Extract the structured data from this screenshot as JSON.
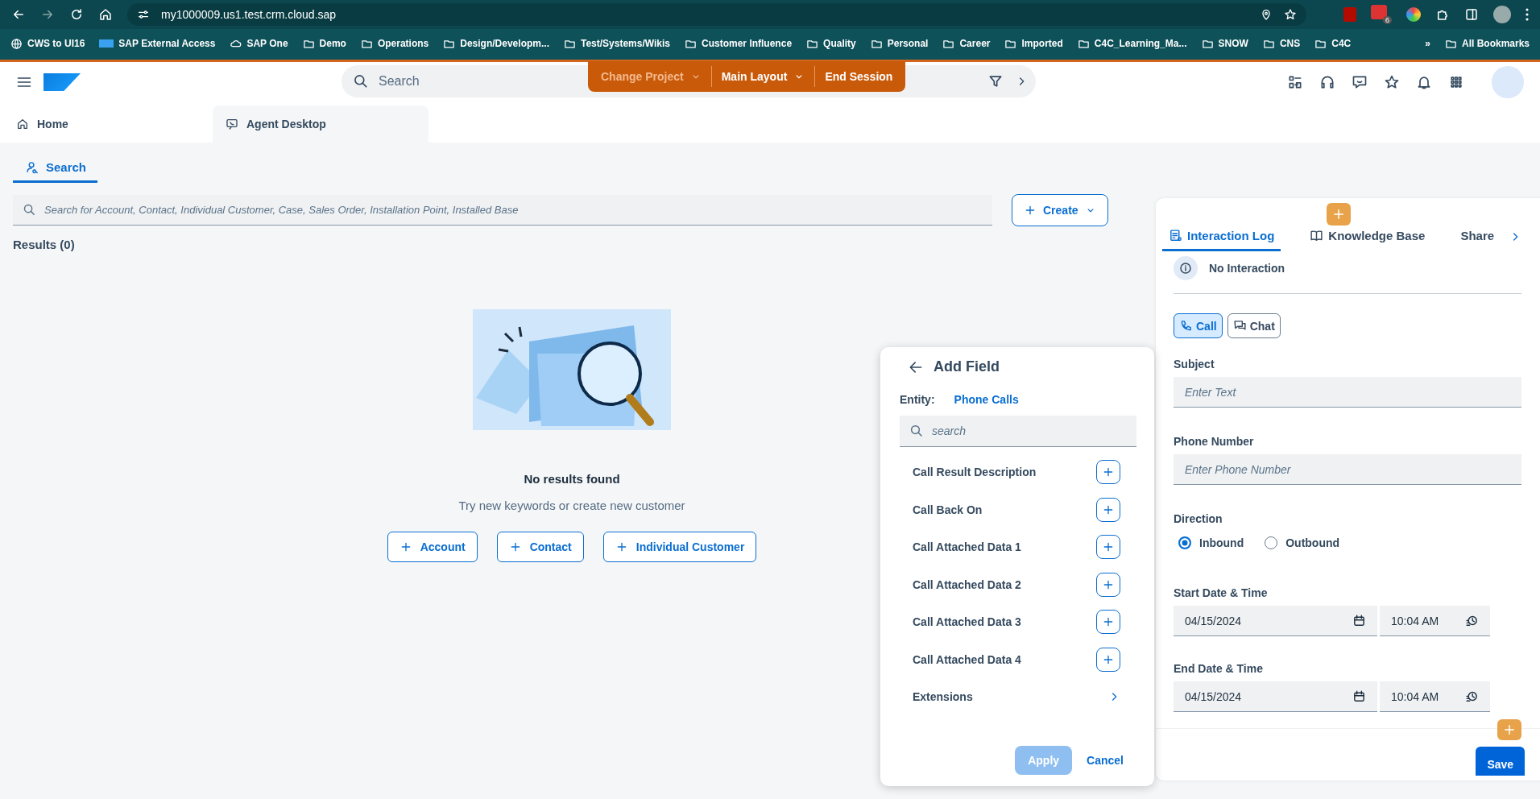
{
  "browser": {
    "url": "my1000009.us1.test.crm.cloud.sap",
    "extension_badge": "6",
    "bookmarks": [
      {
        "label": "CWS to UI16",
        "kind": "globe"
      },
      {
        "label": "SAP External Access",
        "kind": "sap"
      },
      {
        "label": "SAP One",
        "kind": "cloud"
      },
      {
        "label": "Demo",
        "kind": "folder"
      },
      {
        "label": "Operations",
        "kind": "folder"
      },
      {
        "label": "Design/Developm...",
        "kind": "folder"
      },
      {
        "label": "Test/Systems/Wikis",
        "kind": "folder"
      },
      {
        "label": "Customer Influence",
        "kind": "folder"
      },
      {
        "label": "Quality",
        "kind": "folder"
      },
      {
        "label": "Personal",
        "kind": "folder"
      },
      {
        "label": "Career",
        "kind": "folder"
      },
      {
        "label": "Imported",
        "kind": "folder"
      },
      {
        "label": "C4C_Learning_Ma...",
        "kind": "folder"
      },
      {
        "label": "SNOW",
        "kind": "folder"
      },
      {
        "label": "CNS",
        "kind": "folder"
      },
      {
        "label": "C4C",
        "kind": "folder"
      }
    ],
    "overflow": "»",
    "all_bookmarks": "All Bookmarks"
  },
  "shell": {
    "search_placeholder": "Search",
    "actions": [
      {
        "label": "Change Project",
        "dimmed": true,
        "menu": true
      },
      {
        "label": "Main Layout",
        "dimmed": false,
        "menu": true
      },
      {
        "label": "End Session",
        "dimmed": false,
        "menu": false
      }
    ]
  },
  "page_tabs": [
    {
      "label": "Home",
      "kind": "home",
      "selected": false
    },
    {
      "label": "Agent Desktop",
      "kind": "agent",
      "selected": true
    }
  ],
  "search_pane": {
    "tab": "Search",
    "placeholder": "Search for Account, Contact, Individual Customer, Case, Sales Order, Installation Point, Installed Base",
    "create": "Create",
    "results": "Results (0)",
    "empty_title": "No results found",
    "empty_text": "Try new keywords or create new customer",
    "quick_create": [
      "Account",
      "Contact",
      "Individual Customer"
    ]
  },
  "add_field": {
    "title": "Add Field",
    "entity_label": "Entity:",
    "entity": "Phone Calls",
    "search_placeholder": "search",
    "fields": [
      "Call Result Description",
      "Call Back On",
      "Call Attached Data 1",
      "Call Attached Data 2",
      "Call Attached Data 3",
      "Call Attached Data 4"
    ],
    "extensions": "Extensions",
    "apply": {
      "label": "Apply",
      "disabled": true
    },
    "cancel": "Cancel"
  },
  "interaction": {
    "tabs": [
      {
        "label": "Interaction Log",
        "kind": "log",
        "selected": true
      },
      {
        "label": "Knowledge Base",
        "kind": "book",
        "selected": false
      },
      {
        "label": "Share",
        "kind": "none",
        "selected": false
      }
    ],
    "status": "No Interaction",
    "channels": [
      {
        "label": "Call",
        "kind": "phone",
        "selected": true
      },
      {
        "label": "Chat",
        "kind": "chat",
        "selected": false
      }
    ],
    "subject": {
      "label": "Subject",
      "placeholder": "Enter Text"
    },
    "phone": {
      "label": "Phone Number",
      "placeholder": "Enter Phone Number"
    },
    "direction": {
      "label": "Direction",
      "options": [
        {
          "label": "Inbound",
          "selected": true
        },
        {
          "label": "Outbound",
          "selected": false
        }
      ]
    },
    "start": {
      "label": "Start Date & Time",
      "date": "04/15/2024",
      "time": "10:04 AM"
    },
    "end": {
      "label": "End Date & Time",
      "date": "04/15/2024",
      "time": "10:04 AM"
    },
    "save": "Save"
  }
}
